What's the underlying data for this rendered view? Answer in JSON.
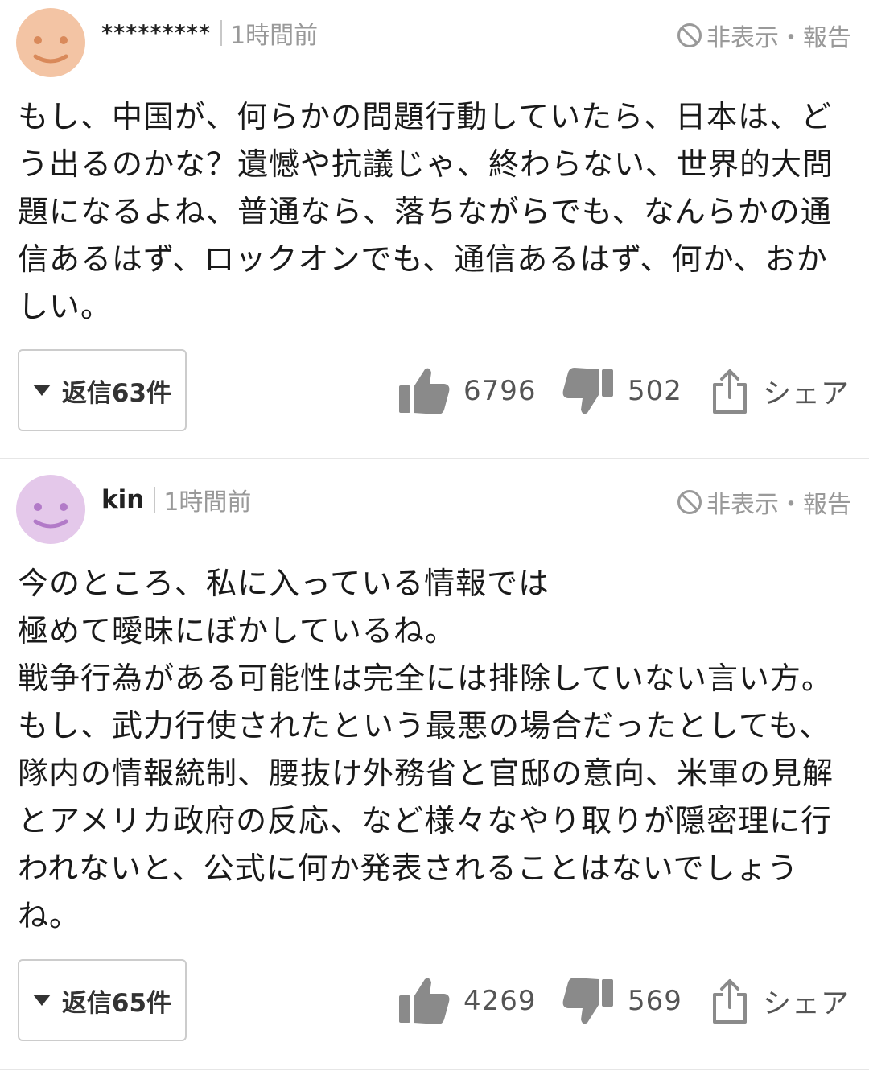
{
  "comments": [
    {
      "username": "*********",
      "timestamp": "1時間前",
      "hide_report": "非表示・報告",
      "body": "もし、中国が、何らかの問題行動していたら、日本は、どう出るのかな？遺憾や抗議じゃ、終わらない、世界的大問題になるよね、普通なら、落ちながらでも、なんらかの通信あるはず、ロックオンでも、通信あるはず、何か、おかしい。",
      "reply_label": "返信63件",
      "likes": "6796",
      "dislikes": "502",
      "share_label": "シェア",
      "avatar_color": "#f3c4a4",
      "avatar_face_color": "#d9895a",
      "avatar_icon": "smiley-face-icon"
    },
    {
      "username": "kin",
      "timestamp": "1時間前",
      "hide_report": "非表示・報告",
      "body": "今のところ、私に入っている情報では\n極めて曖昧にぼかしているね。\n戦争行為がある可能性は完全には排除していない言い方。\nもし、武力行使されたという最悪の場合だったとしても、隊内の情報統制、腰抜け外務省と官邸の意向、米軍の見解とアメリカ政府の反応、など様々なやり取りが隠密理に行われないと、公式に何か発表されることはないでしょうね。",
      "reply_label": "返信65件",
      "likes": "4269",
      "dislikes": "569",
      "share_label": "シェア",
      "avatar_color": "#e4c8ea",
      "avatar_face_color": "#b27ac8",
      "avatar_icon": "smiley-face-icon"
    }
  ],
  "colors": {
    "icon_gray": "#8a8a8a",
    "divider": "#e6e6e6",
    "muted_text": "#999999"
  }
}
